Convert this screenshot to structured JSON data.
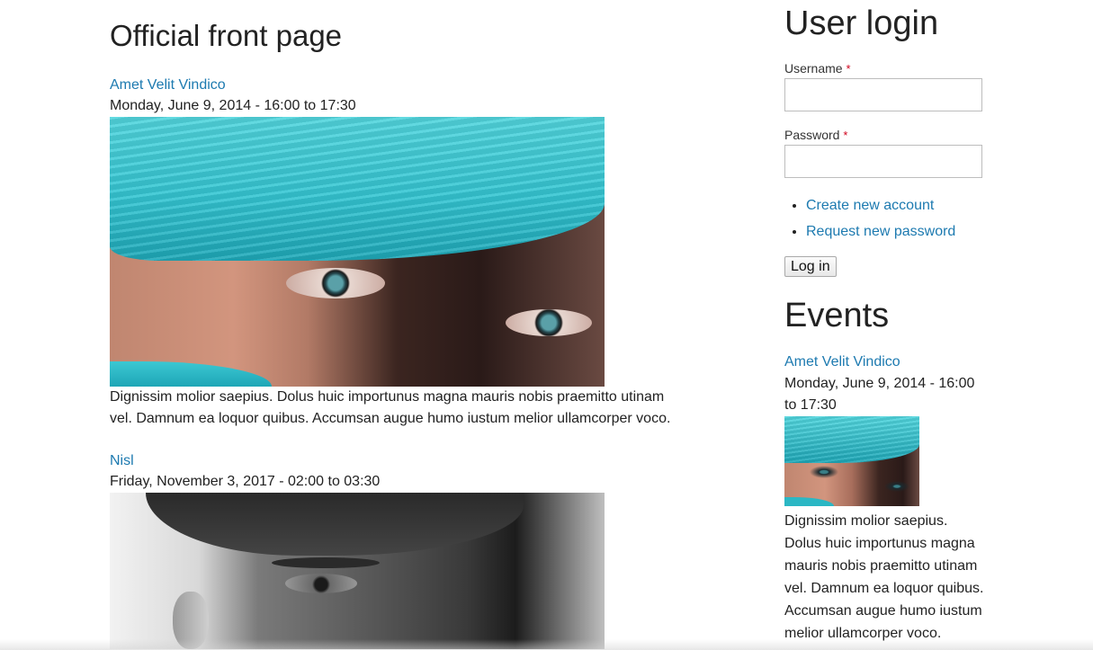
{
  "main": {
    "page_title": "Official front page",
    "nodes": [
      {
        "title": "Amet Velit Vindico",
        "date": "Monday, June 9, 2014 - 16:00 to 17:30",
        "body": "Dignissim molior saepius. Dolus huic importunus magna mauris nobis praemitto utinam vel. Damnum ea loquor quibus. Accumsan augue humo iustum melior ullamcorper voco."
      },
      {
        "title": "Nisl",
        "date": "Friday, November 3, 2017 - 02:00 to 03:30"
      }
    ]
  },
  "sidebar": {
    "login": {
      "title": "User login",
      "username_label": "Username",
      "password_label": "Password",
      "required_mark": "*",
      "username_value": "",
      "password_value": "",
      "links": [
        "Create new account",
        "Request new password"
      ],
      "submit_label": "Log in"
    },
    "events": {
      "title": "Events",
      "item": {
        "title": "Amet Velit Vindico",
        "date": "Monday, June 9, 2014 - 16:00 to 17:30",
        "body": "Dignissim molior saepius. Dolus huic importunus magna mauris nobis praemitto utinam vel. Damnum ea loquor quibus. Accumsan augue humo iustum melior ullamcorper voco."
      }
    }
  },
  "colors": {
    "link": "#1d7ab0",
    "text": "#222222",
    "required": "#d0021b"
  }
}
